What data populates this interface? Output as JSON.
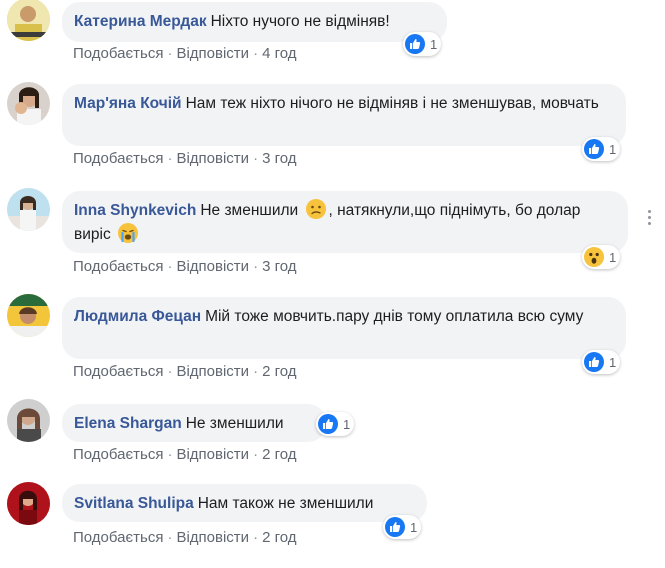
{
  "comments": [
    {
      "author": "Катерина Мердак",
      "text": "Ніхто нучого не відміняв!",
      "like": "Подобається",
      "reply": "Відповісти",
      "time": "4 год",
      "reactions": "1",
      "reaction_icon": "like-icon"
    },
    {
      "author": "Мар'яна Кочій",
      "text": "Нам теж ніхто нічого не відміняв і не зменшував, мовчать",
      "like": "Подобається",
      "reply": "Відповісти",
      "time": "3 год",
      "reactions": "1",
      "reaction_icon": "like-icon"
    },
    {
      "author": "Inna Shynkevich",
      "text_part1": "Не зменшили",
      "text_part2": ", натякнули,що піднімуть, бо долар виріс",
      "like": "Подобається",
      "reply": "Відповісти",
      "time": "3 год",
      "reactions": "1",
      "reaction_icon": "wow-icon"
    },
    {
      "author": "Людмила Фецан",
      "text": "Мій тоже мовчить.пару днів тому оплатила всю суму",
      "like": "Подобається",
      "reply": "Відповісти",
      "time": "2 год",
      "reactions": "1",
      "reaction_icon": "like-icon"
    },
    {
      "author": "Elena Shargan",
      "text": "Не зменшили",
      "like": "Подобається",
      "reply": "Відповісти",
      "time": "2 год",
      "reactions": "1",
      "reaction_icon": "like-icon"
    },
    {
      "author": "Svitlana Shulipa",
      "text": "Нам також не зменшили",
      "like": "Подобається",
      "reply": "Відповісти",
      "time": "2 год",
      "reactions": "1",
      "reaction_icon": "like-icon"
    }
  ],
  "separator": "·",
  "colors": {
    "author": "#385898",
    "bubble": "#f2f3f5",
    "meta": "#606770",
    "like_blue": "#1877f2"
  }
}
